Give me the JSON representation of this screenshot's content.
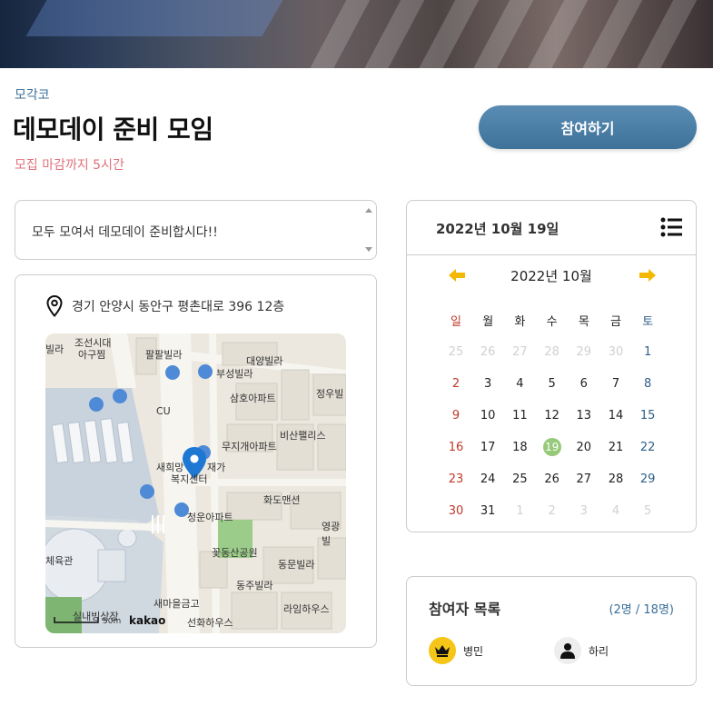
{
  "meeting": {
    "category": "모각코",
    "title": "데모데이 준비 모임",
    "deadline": "모집 마감까지 5시간",
    "join_label": "참여하기",
    "description": "모두 모여서 데모데이 준비합시다!!",
    "address": "경기 안양시 동안구 평촌대로 396 12층"
  },
  "map": {
    "labels": [
      "조선시대",
      "아구찜",
      "빌라",
      "팔팔빌라",
      "대양빌라",
      "부성빌라",
      "정우빌",
      "삼호아파트",
      "CU",
      "비산팰리스",
      "무지개아파트",
      "새희망",
      "재가",
      "복지센터",
      "화도맨션",
      "영광빌",
      "청운아파트",
      "체육관",
      "꽃동산공원",
      "동문빌라",
      "동주빌라",
      "새마을금고",
      "라임하우스",
      "선화하우스",
      "실내빙상장"
    ],
    "scale": "50m",
    "brand": "kakao"
  },
  "calendar": {
    "selected_date": "2022년 10월 19일",
    "month_label": "2022년 10월",
    "weekdays": [
      "일",
      "월",
      "화",
      "수",
      "목",
      "금",
      "토"
    ],
    "weeks": [
      [
        "25",
        "26",
        "27",
        "28",
        "29",
        "30",
        "1"
      ],
      [
        "2",
        "3",
        "4",
        "5",
        "6",
        "7",
        "8"
      ],
      [
        "9",
        "10",
        "11",
        "12",
        "13",
        "14",
        "15"
      ],
      [
        "16",
        "17",
        "18",
        "19",
        "20",
        "21",
        "22"
      ],
      [
        "23",
        "24",
        "25",
        "26",
        "27",
        "28",
        "29"
      ],
      [
        "30",
        "31",
        "1",
        "2",
        "3",
        "4",
        "5"
      ]
    ],
    "today": "19",
    "colors": {
      "sunday": "#c0392b",
      "saturday": "#2e5f8a",
      "today": "#96c97a",
      "arrow": "#f5b800"
    }
  },
  "participants": {
    "title": "참여자 목록",
    "count": "(2명 / 18명)",
    "members": [
      {
        "name": "병민",
        "icon": "crown-icon"
      },
      {
        "name": "하리",
        "icon": "person-icon"
      }
    ]
  }
}
